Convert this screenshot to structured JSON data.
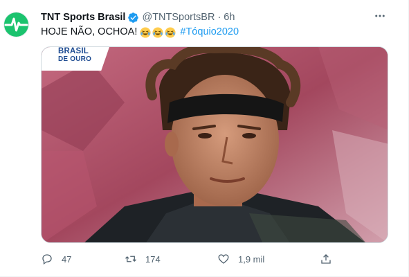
{
  "tweet": {
    "display_name": "TNT Sports Brasil",
    "handle": "@TNTSportsBR",
    "separator": "·",
    "time": "6h",
    "text_main": "HOJE NÃO, OCHOA!",
    "emoji": [
      "face-with-tears-of-joy",
      "face-with-tears-of-joy",
      "face-with-tears-of-joy"
    ],
    "hashtag": "#Tóquio2020",
    "media_badge_line1": "BRASIL",
    "media_badge_line2": "DE OURO",
    "more_icon": "more-horizontal-icon"
  },
  "actions": {
    "reply_count": "47",
    "retweet_count": "174",
    "like_count": "1,9 mil",
    "share_icon": "share-icon"
  },
  "colors": {
    "brand_green": "#1bc36e",
    "link_blue": "#1d9bf0",
    "muted": "#536471",
    "badge_blue": "#1d4b91"
  }
}
